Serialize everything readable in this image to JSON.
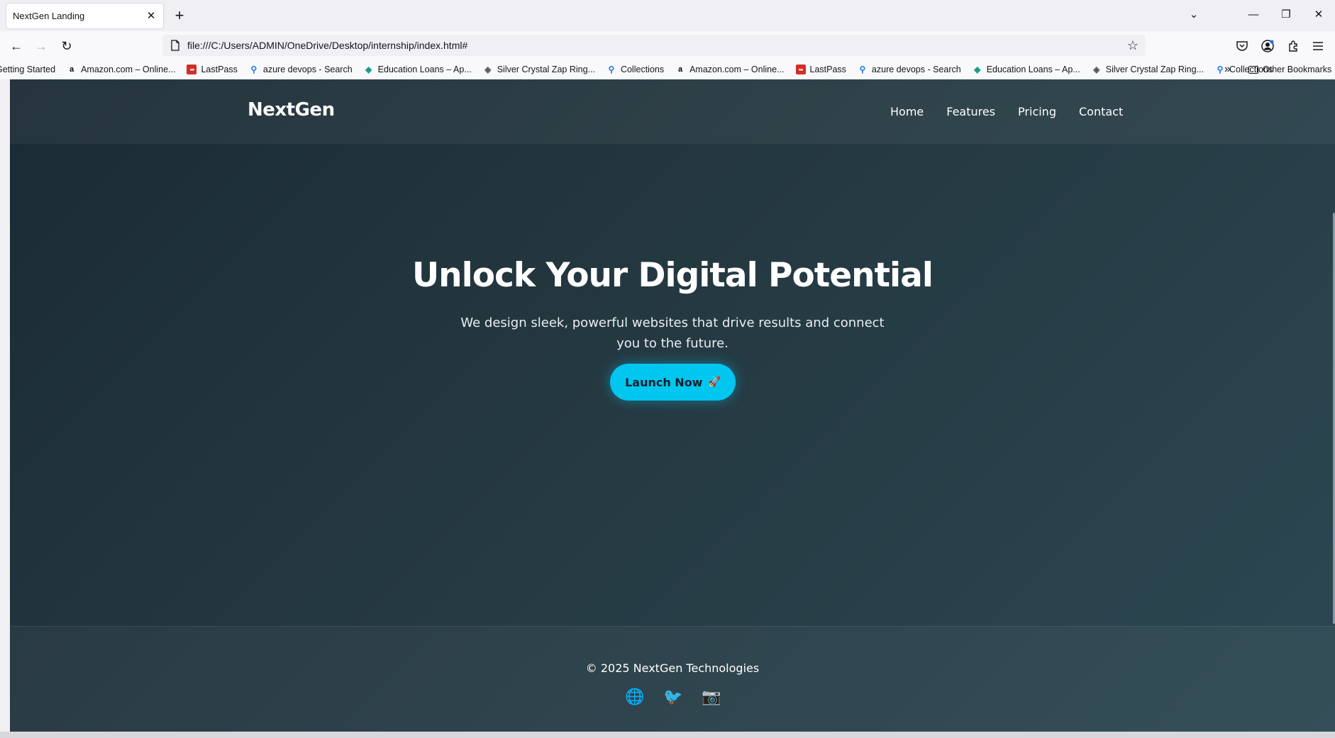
{
  "browser": {
    "tab_title": "NextGen Landing",
    "tab_close": "✕",
    "new_tab": "+",
    "url": "file:///C:/Users/ADMIN/OneDrive/Desktop/internship/index.html#",
    "window_controls": {
      "list": "⌄",
      "minimize": "—",
      "restore": "❐",
      "close": "✕"
    },
    "nav": {
      "back": "←",
      "forward": "→",
      "reload": "↻",
      "star": "☆"
    }
  },
  "bookmarks": {
    "items": [
      {
        "label": "Getting Started",
        "icon": "firefox"
      },
      {
        "label": "Amazon.com – Online...",
        "icon": "amazon"
      },
      {
        "label": "LastPass",
        "icon": "lastpass"
      },
      {
        "label": "azure devops - Search",
        "icon": "search"
      },
      {
        "label": "Education Loans – Ap...",
        "icon": "education"
      },
      {
        "label": "Silver Crystal Zap Ring...",
        "icon": "ring"
      },
      {
        "label": "Collections",
        "icon": "search"
      },
      {
        "label": "Amazon.com – Online...",
        "icon": "amazon"
      },
      {
        "label": "LastPass",
        "icon": "lastpass"
      },
      {
        "label": "azure devops - Search",
        "icon": "search"
      },
      {
        "label": "Education Loans – Ap...",
        "icon": "education"
      },
      {
        "label": "Silver Crystal Zap Ring...",
        "icon": "ring"
      },
      {
        "label": "Collections",
        "icon": "search"
      }
    ],
    "overflow": "»",
    "other": "Other Bookmarks"
  },
  "site": {
    "brand": "NextGen",
    "nav": [
      "Home",
      "Features",
      "Pricing",
      "Contact"
    ],
    "hero": {
      "title": "Unlock Your Digital Potential",
      "subtitle": "We design sleek, powerful websites that drive results and connect you to the future.",
      "cta_label": "Launch Now",
      "cta_icon": "🚀"
    },
    "footer": {
      "copyright": "© 2025 NextGen Technologies",
      "socials": [
        {
          "name": "globe-icon",
          "glyph": "🌐"
        },
        {
          "name": "bird-icon",
          "glyph": "🐦"
        },
        {
          "name": "camera-icon",
          "glyph": "📷"
        }
      ]
    }
  },
  "colors": {
    "accent": "#00c6f0",
    "background_dark": "#1a2a33",
    "background_light": "#2c4853"
  }
}
